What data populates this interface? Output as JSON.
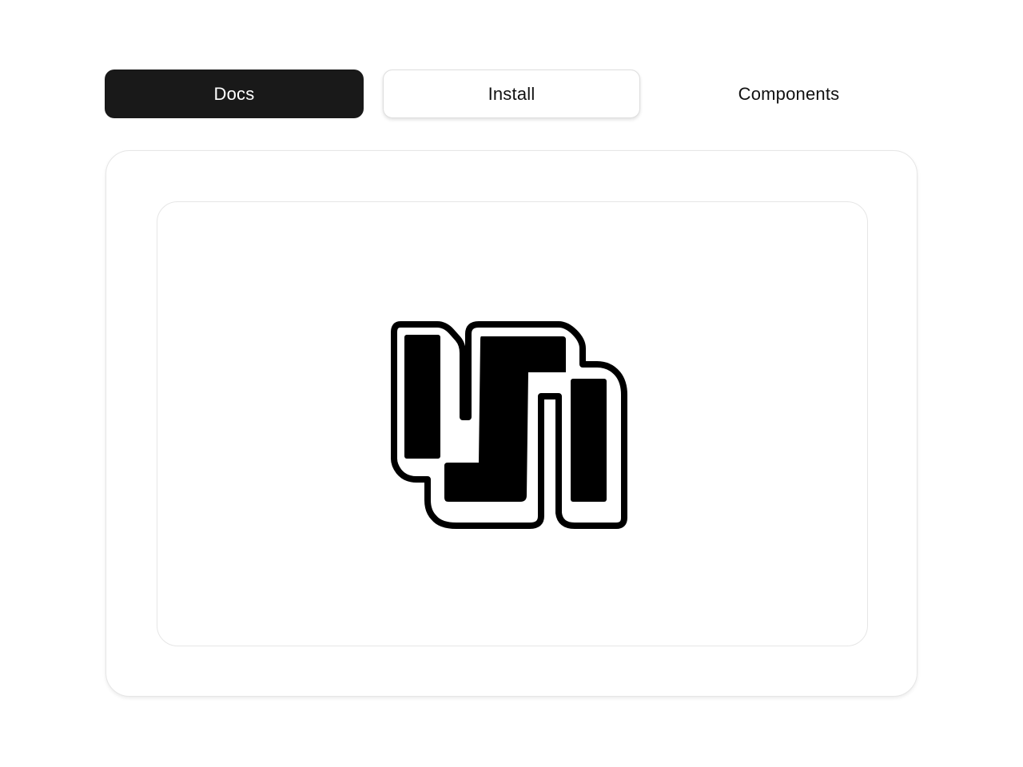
{
  "nav": {
    "docs_label": "Docs",
    "install_label": "Install",
    "components_label": "Components"
  },
  "colors": {
    "active_tab_bg": "#191919",
    "active_tab_text": "#ffffff",
    "text": "#111111",
    "border": "#e6e6e6",
    "logo": "#000000"
  },
  "preview": {
    "logo_icon": "brand-logo-icon"
  }
}
